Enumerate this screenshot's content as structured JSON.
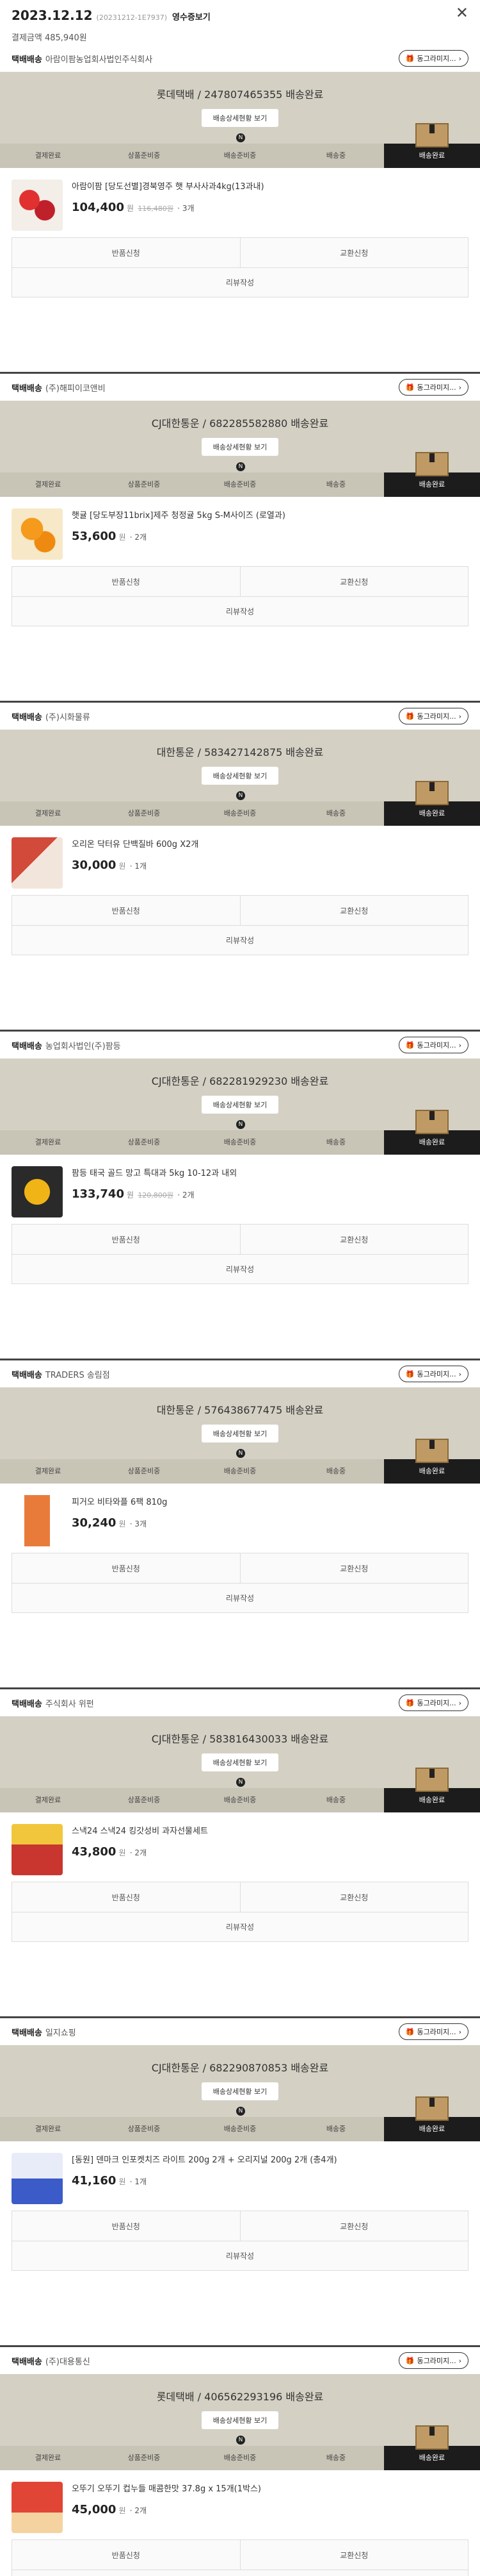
{
  "order": {
    "date": "2023.12.12",
    "number": "(20231212-1E7937)",
    "action": "영수증보기",
    "payment": "결제금액 485,940원"
  },
  "labels": {
    "delivery": "택배배송",
    "track_btn": "배송상세현황 보기",
    "gift": "동그라미지...",
    "steps": [
      "결제완료",
      "상품준비중",
      "배송준비중",
      "배송중",
      "배송완료"
    ],
    "return": "반품신청",
    "exchange": "교환신청",
    "review": "리뷰작성"
  },
  "sections": [
    {
      "seller": "아람이팜농업회사법인주식회사",
      "tracking": "롯데택배 / 247807465355 배송완료",
      "product": "아람이팜 [당도선별]경북영주 햇 부사사과4kg(13과내)",
      "price": "104,400",
      "unit": "원",
      "orig": "116,480원",
      "qty": "· 3개",
      "thumb": "apple"
    },
    {
      "seller": "(주)해피이코앤비",
      "tracking": "CJ대한통운 / 682285582880 배송완료",
      "product": "햇귤 [당도부장11brix]제주 청정귤 5kg S-M사이즈 (로열과)",
      "price": "53,600",
      "unit": "원",
      "orig": "",
      "qty": "· 2개",
      "thumb": "orange"
    },
    {
      "seller": "(주)시화물류",
      "tracking": "대한통운 / 583427142875 배송완료",
      "product": "오리온 닥터유 단백질바 600g X2개",
      "price": "30,000",
      "unit": "원",
      "orig": "",
      "qty": "· 1개",
      "thumb": "bar"
    },
    {
      "seller": "농업회사법인(주)팜등",
      "tracking": "CJ대한통운 / 682281929230 배송완료",
      "product": "팜등 태국 골드 망고 특대과 5kg 10-12과 내외",
      "price": "133,740",
      "unit": "원",
      "orig": "120,800원",
      "qty": "· 2개",
      "thumb": "mango"
    },
    {
      "seller": "TRADERS 송림점",
      "tracking": "대한통운 / 576438677475 배송완료",
      "product": "피거오 비타와플 6팩 810g",
      "price": "30,240",
      "unit": "원",
      "orig": "",
      "qty": "· 3개",
      "thumb": "snack"
    },
    {
      "seller": "주식회사 위펀",
      "tracking": "CJ대한통운 / 583816430033 배송완료",
      "product": "스낵24 스낵24 킹갓성비 과자선물세트",
      "price": "43,800",
      "unit": "원",
      "orig": "",
      "qty": "· 2개",
      "thumb": "gift"
    },
    {
      "seller": "일지쇼핑",
      "tracking": "CJ대한통운 / 682290870853 배송완료",
      "product": "[동원] 덴마크 인포켓치즈 라이트 200g 2개 + 오리지널 200g 2개 (총4개)",
      "price": "41,160",
      "unit": "원",
      "orig": "",
      "qty": "· 1개",
      "thumb": "cheese"
    },
    {
      "seller": "(주)대용통신",
      "tracking": "롯데택배 / 406562293196 배송완료",
      "product": "오뚜기 오뚜기 컵누들 매콤한맛 37.8g x 15개(1박스)",
      "price": "45,000",
      "unit": "원",
      "orig": "",
      "qty": "· 2개",
      "thumb": "noodle"
    }
  ]
}
